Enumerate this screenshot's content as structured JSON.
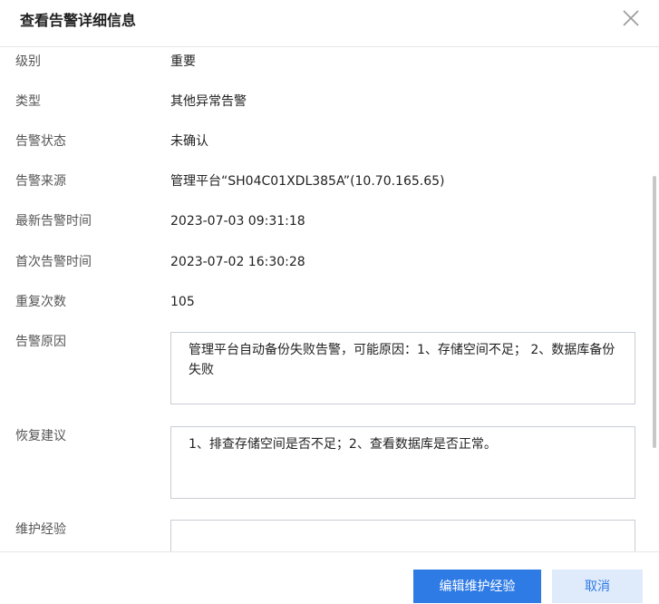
{
  "dialog": {
    "title": "查看告警详细信息"
  },
  "fields": [
    {
      "label": "级别",
      "value": "重要"
    },
    {
      "label": "类型",
      "value": "其他异常告警"
    },
    {
      "label": "告警状态",
      "value": "未确认"
    },
    {
      "label": "告警来源",
      "value": "管理平台“SH04C01XDL385A”(10.70.165.65)"
    },
    {
      "label": "最新告警时间",
      "value": "2023-07-03 09:31:18"
    },
    {
      "label": "首次告警时间",
      "value": "2023-07-02 16:30:28"
    },
    {
      "label": "重复次数",
      "value": "105"
    }
  ],
  "reason": {
    "label": "告警原因",
    "text": "管理平台自动备份失败告警，可能原因：1、存储空间不足； 2、数据库备份失败"
  },
  "suggestion": {
    "label": "恢复建议",
    "text": "1、排查存储空间是否不足；2、查看数据库是否正常。"
  },
  "experience": {
    "label": "维护经验",
    "text": ""
  },
  "footer": {
    "edit_label": "编辑维护经验",
    "cancel_label": "取消"
  },
  "colors": {
    "primary": "#2f7be6",
    "secondary_bg": "#dfebfb"
  },
  "icons": {
    "close": "close-icon"
  }
}
